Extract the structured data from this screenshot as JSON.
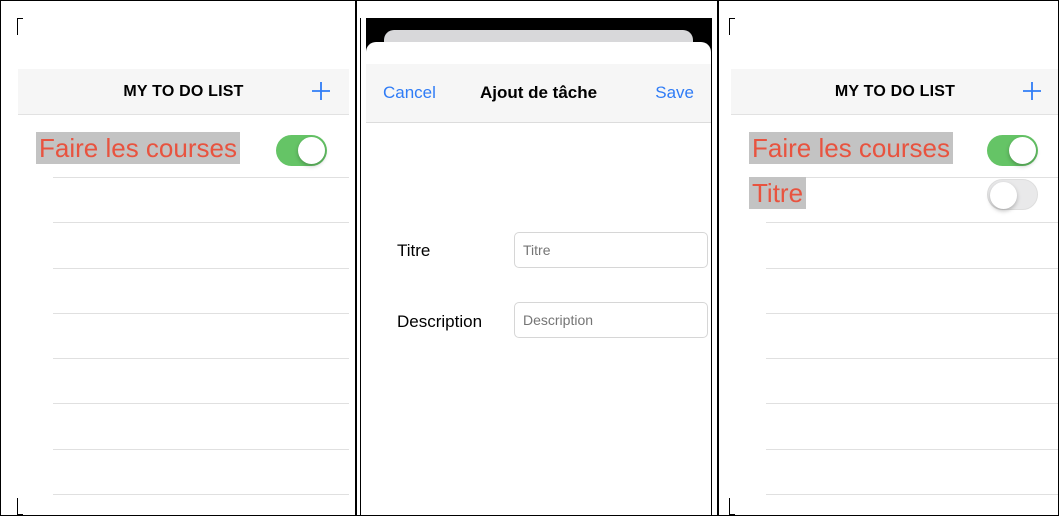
{
  "screen_list": {
    "title": "MY TO DO LIST",
    "add_icon": "plus-icon",
    "tasks": [
      {
        "label": "Faire les courses",
        "done": true
      }
    ]
  },
  "screen_add": {
    "cancel_label": "Cancel",
    "title": "Ajout de tâche",
    "save_label": "Save",
    "fields": {
      "title_label": "Titre",
      "title_placeholder": "Titre",
      "description_label": "Description",
      "description_placeholder": "Description"
    }
  },
  "screen_list_updated": {
    "title": "MY TO DO LIST",
    "add_icon": "plus-icon",
    "tasks": [
      {
        "label": "Faire les courses",
        "done": true
      },
      {
        "label": "Titre",
        "done": false
      }
    ]
  },
  "colors": {
    "accent": "#2f7cf6",
    "task_text": "#e8533f",
    "task_highlight": "#c3c3c3",
    "toggle_on": "#65c466",
    "toggle_off": "#e9e9ea"
  }
}
